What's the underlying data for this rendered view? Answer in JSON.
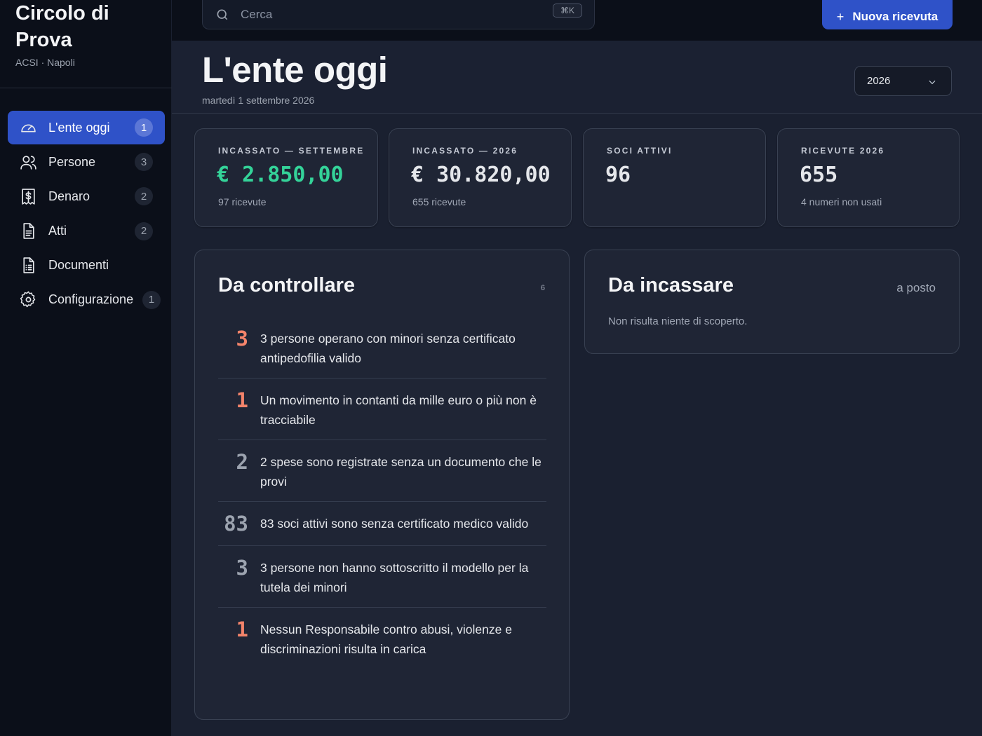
{
  "org": {
    "name": "Circolo di Prova",
    "subtitle": "ACSI · Napoli"
  },
  "nav": [
    {
      "label": "L'ente oggi",
      "badge": "1",
      "icon": "gauge-icon",
      "active": true
    },
    {
      "label": "Persone",
      "badge": "3",
      "icon": "users-icon"
    },
    {
      "label": "Denaro",
      "badge": "2",
      "icon": "receipt-dollar-icon"
    },
    {
      "label": "Atti",
      "badge": "2",
      "icon": "document-icon"
    },
    {
      "label": "Documenti",
      "badge": "",
      "icon": "document-list-icon"
    },
    {
      "label": "Configurazione",
      "badge": "1",
      "icon": "gear-icon"
    }
  ],
  "search": {
    "placeholder": "Cerca",
    "shortcut": "⌘K"
  },
  "new_button": {
    "plus": "+",
    "label": "Nuova ricevuta"
  },
  "header": {
    "title": "L'ente oggi",
    "date": "martedì 1 settembre 2026",
    "year": "2026"
  },
  "stats": [
    {
      "label": "INCASSATO — SETTEMBRE",
      "value": "€ 2.850,00",
      "sub": "97 ricevute",
      "accent": "#34d399"
    },
    {
      "label": "INCASSATO — 2026",
      "value": "€ 30.820,00",
      "sub": "655 ricevute"
    },
    {
      "label": "SOCI ATTIVI",
      "value": "96",
      "sub": ""
    },
    {
      "label": "RICEVUTE 2026",
      "value": "655",
      "sub": "4 numeri non usati"
    }
  ],
  "checks": {
    "title": "Da controllare",
    "count": "6",
    "items": [
      {
        "num": "3",
        "text": "3 persone operano con minori senza certificato antipedofilia valido",
        "severity": "red"
      },
      {
        "num": "1",
        "text": "Un movimento in contanti da mille euro o più non è tracciabile",
        "severity": "red"
      },
      {
        "num": "2",
        "text": "2 spese sono registrate senza un documento che le provi",
        "severity": "gray"
      },
      {
        "num": "83",
        "text": "83 soci attivi sono senza certificato medico valido",
        "severity": "gray"
      },
      {
        "num": "3",
        "text": "3 persone non hanno sottoscritto il modello per la tutela dei minori",
        "severity": "gray"
      },
      {
        "num": "1",
        "text": "Nessun Responsabile contro abusi, violenze e discriminazioni risulta in carica",
        "severity": "red"
      }
    ]
  },
  "collect": {
    "title": "Da incassare",
    "status": "a posto",
    "empty": "Non risulta niente di scoperto."
  },
  "colors": {
    "accent": "#2f52c8",
    "positive": "#34d399",
    "warning": "#f4846b"
  }
}
